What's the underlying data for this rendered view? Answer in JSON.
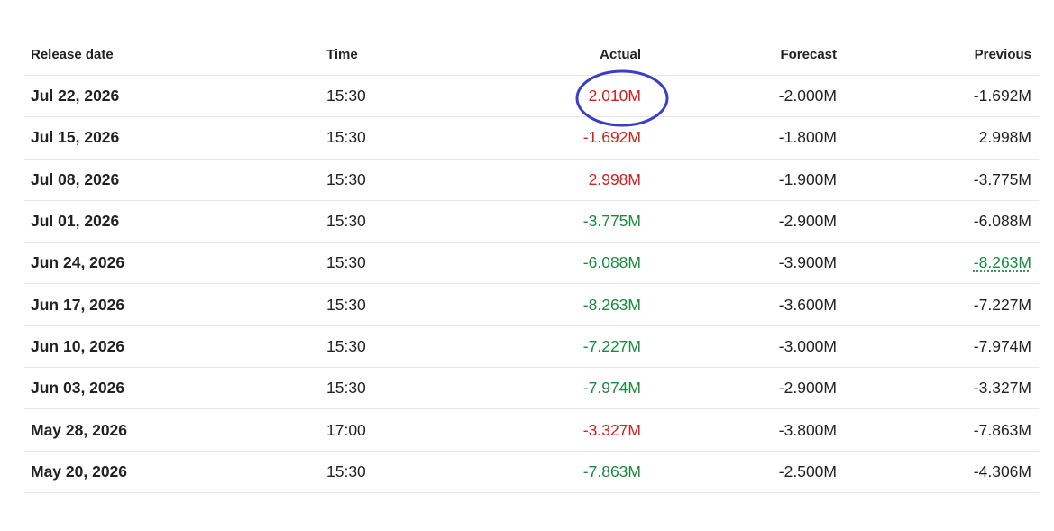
{
  "headers": {
    "release_date": "Release date",
    "time": "Time",
    "actual": "Actual",
    "forecast": "Forecast",
    "previous": "Previous"
  },
  "colors": {
    "negative_actual": "#d0201c",
    "positive_actual": "#1a8a3e",
    "highlight_ring": "#3a3fc4"
  },
  "rows": [
    {
      "date": "Jul 22, 2026",
      "time": "15:30",
      "actual": "2.010M",
      "actual_color": "red",
      "forecast": "-2.000M",
      "previous": "-1.692M"
    },
    {
      "date": "Jul 15, 2026",
      "time": "15:30",
      "actual": "-1.692M",
      "actual_color": "red",
      "forecast": "-1.800M",
      "previous": "2.998M"
    },
    {
      "date": "Jul 08, 2026",
      "time": "15:30",
      "actual": "2.998M",
      "actual_color": "red",
      "forecast": "-1.900M",
      "previous": "-3.775M"
    },
    {
      "date": "Jul 01, 2026",
      "time": "15:30",
      "actual": "-3.775M",
      "actual_color": "green",
      "forecast": "-2.900M",
      "previous": "-6.088M"
    },
    {
      "date": "Jun 24, 2026",
      "time": "15:30",
      "actual": "-6.088M",
      "actual_color": "green",
      "forecast": "-3.900M",
      "previous": "-8.263M",
      "previous_revised": true
    },
    {
      "date": "Jun 17, 2026",
      "time": "15:30",
      "actual": "-8.263M",
      "actual_color": "green",
      "forecast": "-3.600M",
      "previous": "-7.227M"
    },
    {
      "date": "Jun 10, 2026",
      "time": "15:30",
      "actual": "-7.227M",
      "actual_color": "green",
      "forecast": "-3.000M",
      "previous": "-7.974M"
    },
    {
      "date": "Jun 03, 2026",
      "time": "15:30",
      "actual": "-7.974M",
      "actual_color": "green",
      "forecast": "-2.900M",
      "previous": "-3.327M"
    },
    {
      "date": "May 28, 2026",
      "time": "17:00",
      "actual": "-3.327M",
      "actual_color": "red",
      "forecast": "-3.800M",
      "previous": "-7.863M"
    },
    {
      "date": "May 20, 2026",
      "time": "15:30",
      "actual": "-7.863M",
      "actual_color": "green",
      "forecast": "-2.500M",
      "previous": "-4.306M"
    }
  ]
}
